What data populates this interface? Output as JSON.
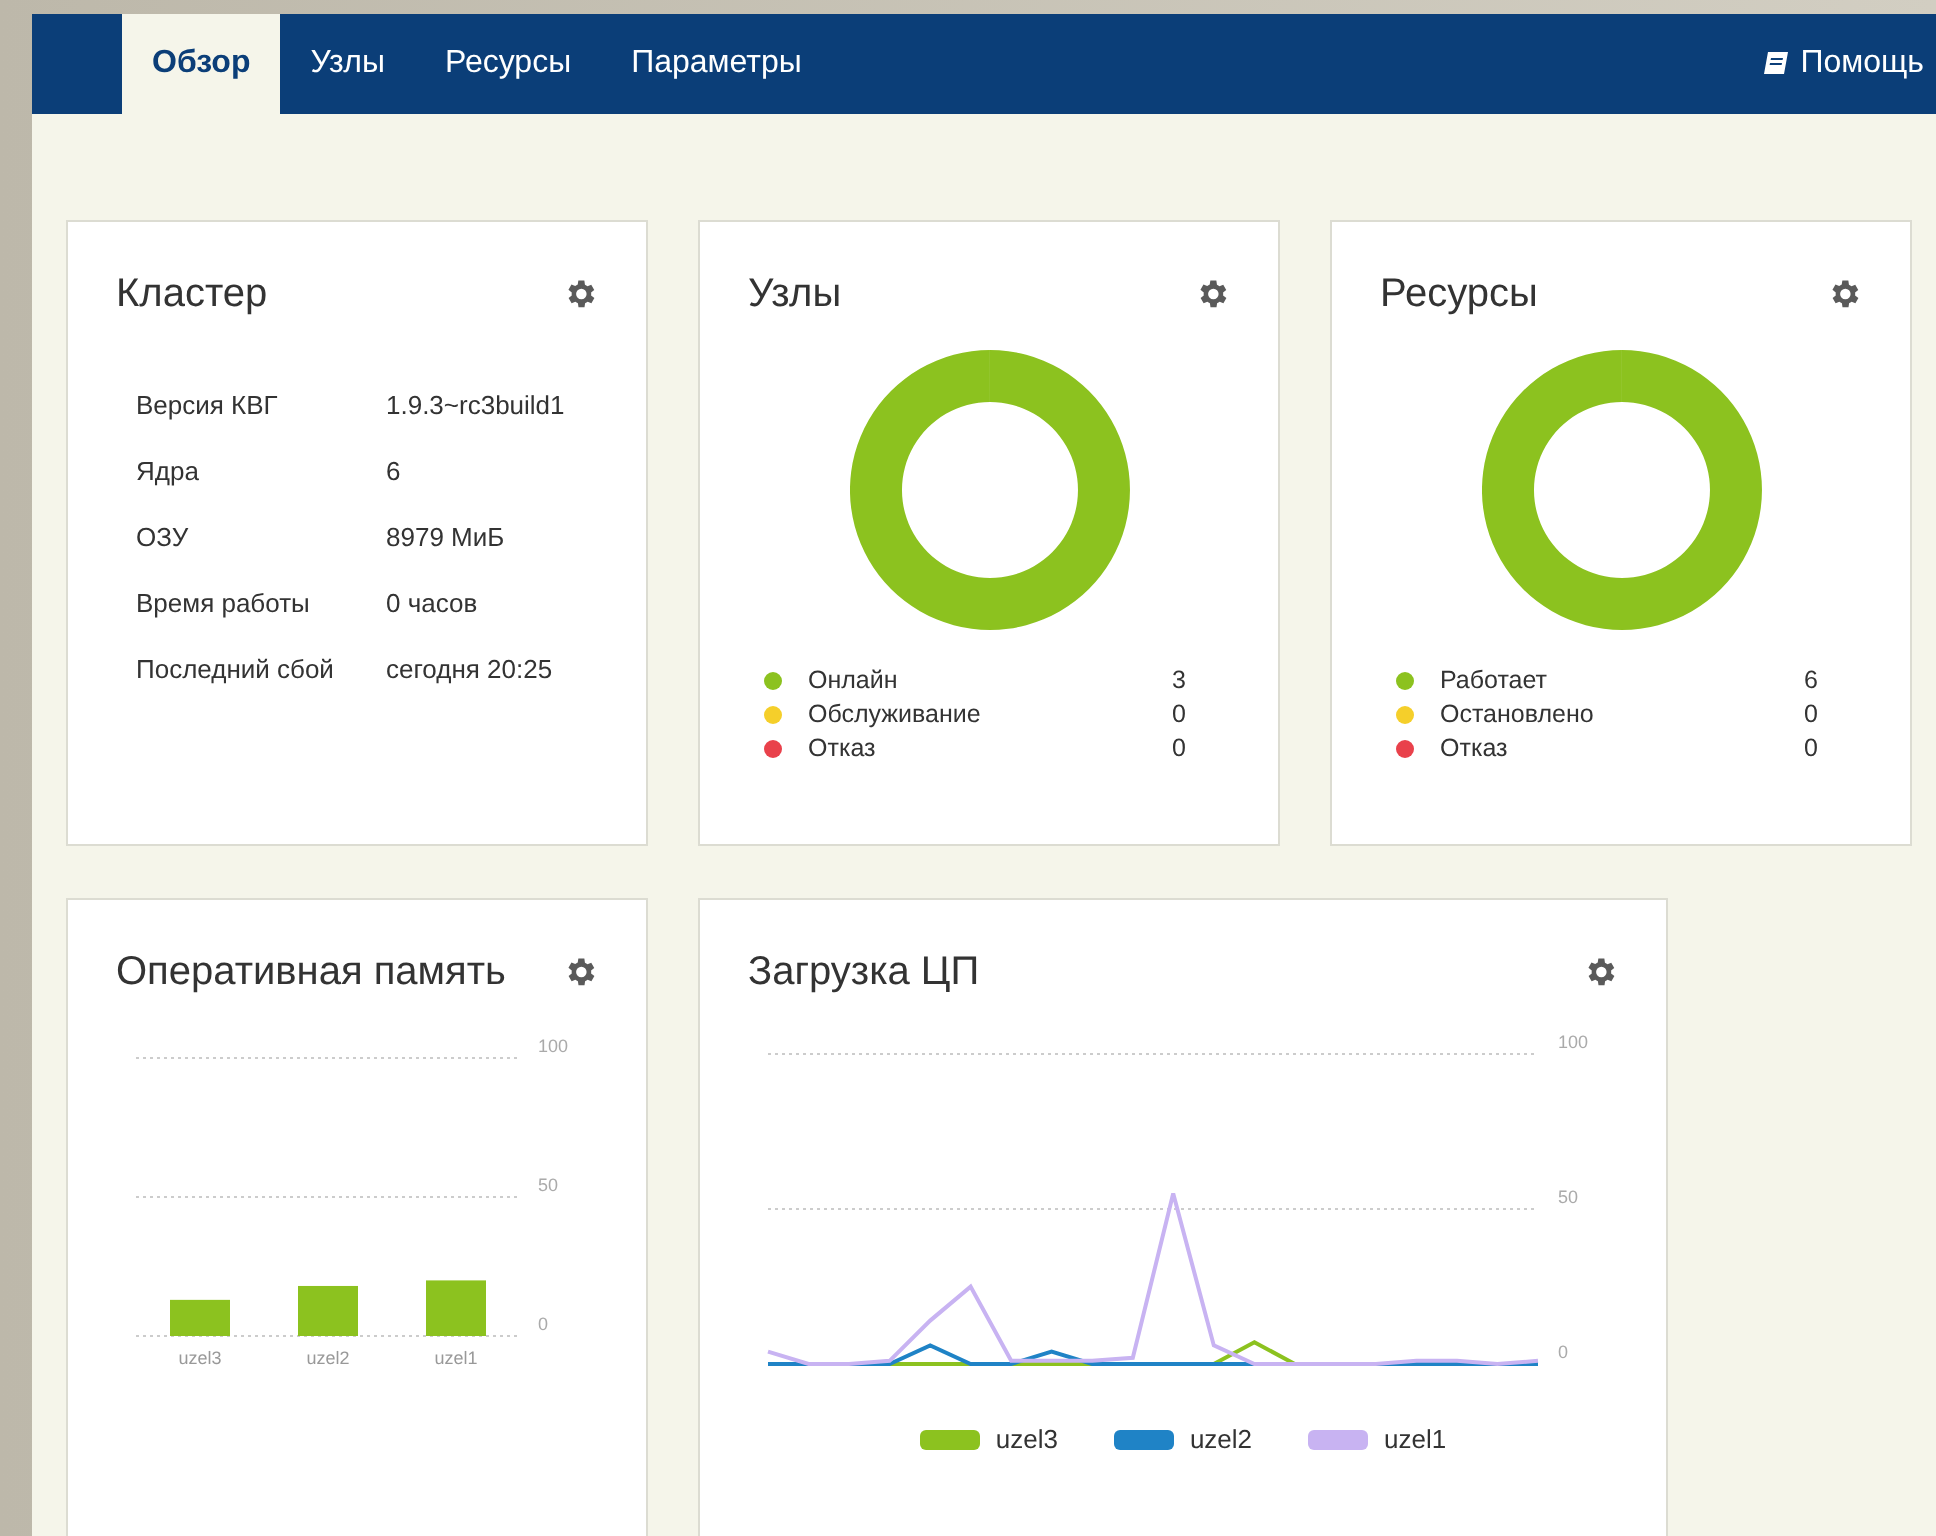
{
  "nav": {
    "tabs": [
      {
        "label": "Обзор",
        "selected": true
      },
      {
        "label": "Узлы",
        "selected": false
      },
      {
        "label": "Ресурсы",
        "selected": false
      },
      {
        "label": "Параметры",
        "selected": false
      }
    ],
    "help": "Помощь"
  },
  "cluster": {
    "title": "Кластер",
    "rows": [
      {
        "label": "Версия КВГ",
        "value": "1.9.3~rc3build1"
      },
      {
        "label": "Ядра",
        "value": "6"
      },
      {
        "label": "ОЗУ",
        "value": "8979 МиБ"
      },
      {
        "label": "Время работы",
        "value": "0 часов"
      },
      {
        "label": "Последний сбой",
        "value": "сегодня 20:25"
      }
    ]
  },
  "nodes": {
    "title": "Узлы",
    "legend": [
      {
        "label": "Онлайн",
        "count": "3",
        "color": "#8cc21f"
      },
      {
        "label": "Обслуживание",
        "count": "0",
        "color": "#f5cf2a"
      },
      {
        "label": "Отказ",
        "count": "0",
        "color": "#e9414b"
      }
    ]
  },
  "resources": {
    "title": "Ресурсы",
    "legend": [
      {
        "label": "Работает",
        "count": "6",
        "color": "#8cc21f"
      },
      {
        "label": "Остановлено",
        "count": "0",
        "color": "#f5cf2a"
      },
      {
        "label": "Отказ",
        "count": "0",
        "color": "#e9414b"
      }
    ]
  },
  "memory": {
    "title": "Оперативная память",
    "chart_data": {
      "type": "bar",
      "categories": [
        "uzel3",
        "uzel2",
        "uzel1"
      ],
      "ylim": [
        0,
        100
      ],
      "yticks": [
        0,
        50,
        100
      ],
      "series": [
        {
          "color": "#8cc21f",
          "values": [
            13,
            18,
            20
          ]
        }
      ]
    }
  },
  "cpu": {
    "title": "Загрузка ЦП",
    "chart_data": {
      "type": "line",
      "ylim": [
        0,
        100
      ],
      "yticks": [
        0,
        50,
        100
      ],
      "series": [
        {
          "name": "uzel3",
          "color": "#8cc21f",
          "values": [
            null,
            null,
            null,
            0,
            0,
            0,
            0,
            0,
            0,
            null,
            null,
            0,
            7,
            0,
            null,
            null,
            null,
            null,
            null,
            null
          ]
        },
        {
          "name": "uzel2",
          "color": "#1f83c6",
          "values": [
            0,
            0,
            0,
            0,
            6,
            0,
            0,
            4,
            0,
            0,
            0,
            0,
            0,
            0,
            0,
            0,
            0,
            0,
            0,
            0
          ]
        },
        {
          "name": "uzel1",
          "color": "#c8b3f2",
          "values": [
            4,
            0,
            0,
            1,
            14,
            25,
            1,
            1,
            1,
            2,
            55,
            6,
            0,
            0,
            0,
            0,
            1,
            1,
            0,
            1
          ]
        }
      ]
    }
  }
}
